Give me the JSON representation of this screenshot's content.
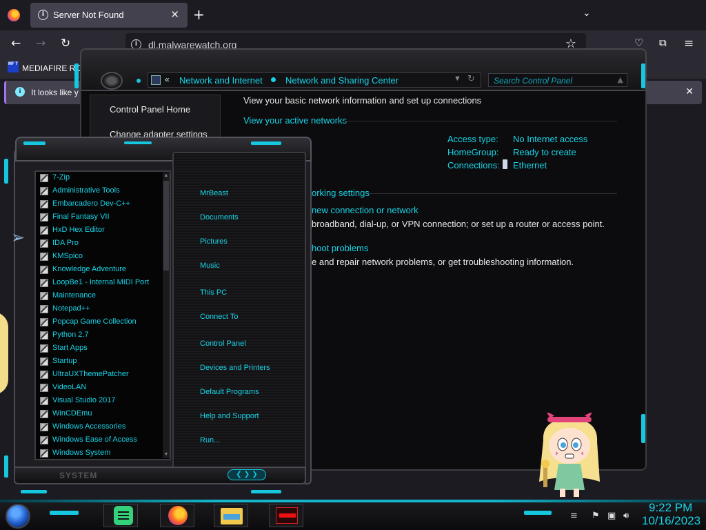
{
  "browser": {
    "tab_title": "Server Not Found",
    "url": "dl.malwarewatch.org",
    "bookmark_label": "MEDIAFIRE RO",
    "bookmark_icon_text": "MF T",
    "notification_text": "It looks like y",
    "icons": [
      "firefox-icon",
      "info-icon",
      "close-icon",
      "plus-icon",
      "chevron-down-icon",
      "back-icon",
      "forward-icon",
      "reload-icon",
      "star-icon",
      "pocket-icon",
      "extensions-icon",
      "menu-icon"
    ]
  },
  "control_panel": {
    "breadcrumb_sep": "«",
    "breadcrumbs": [
      "Network and Internet",
      "Network and Sharing Center"
    ],
    "search_placeholder": "Search Control Panel",
    "sidebar": [
      "Control Panel Home",
      "Change adapter settings"
    ],
    "heading": "View your basic network information and set up connections",
    "active_networks": "View your active networks",
    "access_type_label": "Access type:",
    "access_type_value": "No Internet access",
    "homegroup_label": "HomeGroup:",
    "homegroup_value": "Ready to create",
    "connections_label": "Connections:",
    "connections_value": "Ethernet",
    "change_settings": "orking settings",
    "new_connection": "new connection or network",
    "new_connection_desc": "broadband, dial-up, or VPN connection; or set up a router or access point.",
    "troubleshoot": "hoot problems",
    "troubleshoot_desc": "e and repair network problems, or get troubleshooting information."
  },
  "start_menu": {
    "programs": [
      "7-Zip",
      "Administrative Tools",
      "Embarcadero Dev-C++",
      "Final Fantasy VII",
      "HxD Hex Editor",
      "IDA Pro",
      "KMSpico",
      "Knowledge Adventure",
      "LoopBe1 - Internal MIDI Port",
      "Maintenance",
      "Notepad++",
      "Popcap Game Collection",
      "Python 2.7",
      "Start Apps",
      "Startup",
      "UltraUXThemePatcher",
      "VideoLAN",
      "Visual Studio 2017",
      "WinCDEmu",
      "Windows Accessories",
      "Windows Ease of Access",
      "Windows System"
    ],
    "places": [
      "MrBeast",
      "Documents",
      "Pictures",
      "Music",
      "This PC",
      "Connect To",
      "Control Panel",
      "Devices and Printers",
      "Default Programs",
      "Help and Support",
      "Run..."
    ],
    "footer_label": "SYSTEM",
    "footer_arrows": "❮ ❯ ❯"
  },
  "taskbar": {
    "time": "9:22 PM",
    "date": "10/16/2023",
    "apps": [
      "notes-icon",
      "firefox-icon",
      "file-explorer-icon",
      "app-icon"
    ]
  },
  "colors": {
    "accent": "#16d4e8",
    "firefox_bg": "#1c1b22",
    "toolbar": "#2b2a33"
  }
}
